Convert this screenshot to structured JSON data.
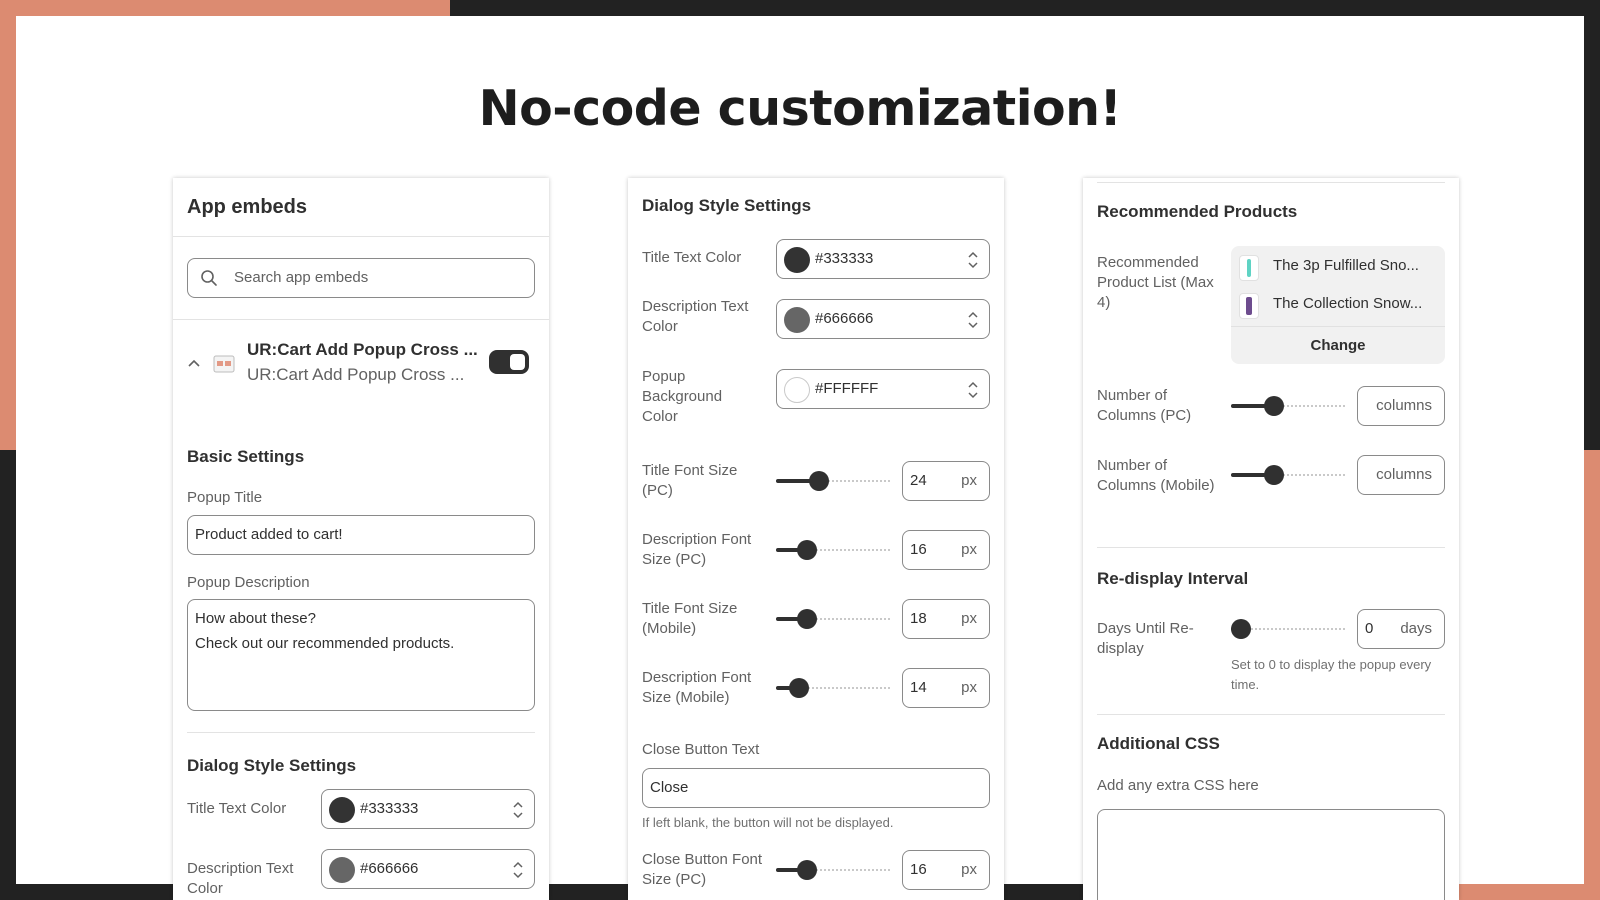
{
  "headline": "No-code customization!",
  "colors": {
    "accent": "#dc8b71",
    "frame": "#222222",
    "dark": "#303030"
  },
  "panel1": {
    "header": "App embeds",
    "search_placeholder": "Search app embeds",
    "embed": {
      "title": "UR:Cart Add Popup Cross ...",
      "subtitle": "UR:Cart Add Popup Cross ...",
      "enabled": true
    },
    "basic_settings": "Basic Settings",
    "popup_title_label": "Popup Title",
    "popup_title_value": "Product added to cart!",
    "popup_desc_label": "Popup Description",
    "popup_desc_line1": "How about these?",
    "popup_desc_line2": "Check out our recommended products.",
    "dialog_style": "Dialog Style Settings",
    "title_color_label": "Title Text Color",
    "title_color_value": "#333333",
    "desc_color_label": "Description Text Color",
    "desc_color_value": "#666666"
  },
  "panel2": {
    "header": "Dialog Style Settings",
    "title_color_label": "Title Text Color",
    "title_color_value": "#333333",
    "desc_color_label": "Description Text Color",
    "desc_color_value": "#666666",
    "bg_color_label": "Popup Background Color",
    "bg_color_value": "#FFFFFF",
    "sliders": [
      {
        "label": "Title Font Size (PC)",
        "value": "24",
        "unit": "px",
        "fraction": 0.35
      },
      {
        "label": "Description Font Size (PC)",
        "value": "16",
        "unit": "px",
        "fraction": 0.22
      },
      {
        "label": "Title Font Size (Mobile)",
        "value": "18",
        "unit": "px",
        "fraction": 0.22
      },
      {
        "label": "Description Font Size (Mobile)",
        "value": "14",
        "unit": "px",
        "fraction": 0.14
      }
    ],
    "close_text_label": "Close Button Text",
    "close_text_value": "Close",
    "close_help": "If left blank, the button will not be displayed.",
    "close_font": {
      "label": "Close Button Font Size (PC)",
      "value": "16",
      "unit": "px",
      "fraction": 0.22
    }
  },
  "panel3": {
    "recommended_header": "Recommended Products",
    "list_label": "Recommended Product List (Max 4)",
    "products": [
      "The 3p Fulfilled Sno...",
      "The Collection Snow..."
    ],
    "change_label": "Change",
    "cols_pc": {
      "label": "Number of Columns (PC)",
      "unit": "columns",
      "fraction": 0.35
    },
    "cols_mobile": {
      "label": "Number of Columns (Mobile)",
      "unit": "columns",
      "fraction": 0.35
    },
    "redisplay_header": "Re-display Interval",
    "days": {
      "label": "Days Until Re-display",
      "value": "0",
      "unit": "days",
      "fraction": 0.0
    },
    "days_help": "Set to 0 to display the popup every time.",
    "css_header": "Additional CSS",
    "css_label": "Add any extra CSS here"
  }
}
